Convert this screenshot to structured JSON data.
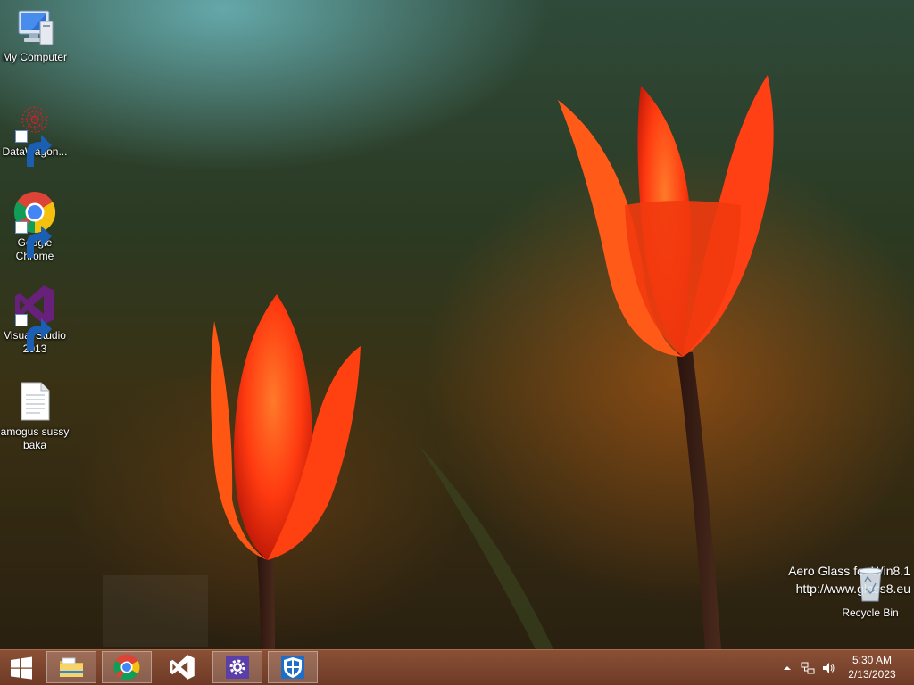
{
  "desktop": {
    "icons": [
      {
        "label": "My Computer",
        "icon": "computer-icon",
        "shortcut": false
      },
      {
        "label": "DataWagon...",
        "icon": "datawagon-icon",
        "shortcut": true
      },
      {
        "label": "Google Chrome",
        "icon": "chrome-icon",
        "shortcut": true
      },
      {
        "label": "Visual Studio 2013",
        "icon": "visual-studio-icon",
        "shortcut": true
      },
      {
        "label": "amogus sussy baka",
        "icon": "text-document-icon",
        "shortcut": false
      }
    ],
    "recycle_bin": {
      "label": "Recycle Bin",
      "icon": "recycle-bin-icon"
    },
    "watermark": {
      "line1": "Aero Glass for Win8.1",
      "line2": "http://www.glass8.eu"
    }
  },
  "taskbar": {
    "start_icon": "windows-logo-icon",
    "pinned": [
      {
        "name": "File Explorer",
        "icon": "file-explorer-icon",
        "state": "highlighted"
      },
      {
        "name": "Google Chrome",
        "icon": "chrome-icon",
        "state": "highlighted"
      },
      {
        "name": "Visual Studio",
        "icon": "visual-studio-icon",
        "state": "plain"
      },
      {
        "name": "Settings",
        "icon": "settings-icon",
        "state": "highlighted"
      },
      {
        "name": "Windows Defender",
        "icon": "shield-icon",
        "state": "highlighted"
      }
    ],
    "tray": {
      "icons": [
        "show-hidden-icons-icon",
        "network-icon",
        "volume-icon"
      ],
      "time": "5:30 AM",
      "date": "2/13/2023"
    }
  },
  "colors": {
    "taskbar": "#7a4430",
    "chrome_red": "#db4437",
    "chrome_yellow": "#f4c20d",
    "chrome_green": "#0f9d58",
    "chrome_blue": "#4285f4",
    "vs_purple": "#68217a",
    "tulip": "#ff4a12"
  }
}
